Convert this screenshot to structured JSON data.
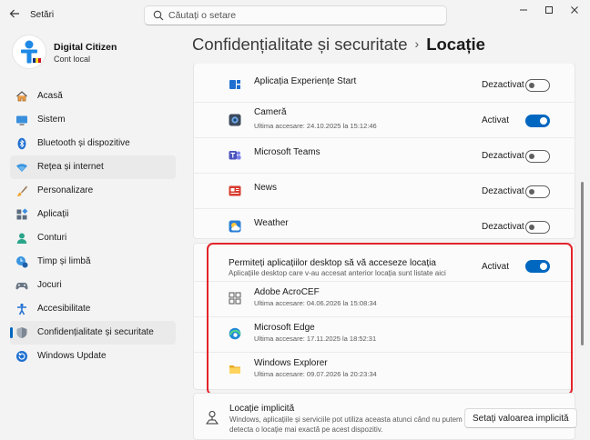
{
  "window": {
    "title": "Setări",
    "search_placeholder": "Căutați o setare"
  },
  "profile": {
    "name": "Digital Citizen",
    "account_type": "Cont local"
  },
  "sidebar": {
    "items": [
      {
        "label": "Acasă",
        "icon": "home-icon"
      },
      {
        "label": "Sistem",
        "icon": "system-icon"
      },
      {
        "label": "Bluetooth și dispozitive",
        "icon": "bluetooth-icon"
      },
      {
        "label": "Rețea și internet",
        "icon": "wifi-icon"
      },
      {
        "label": "Personalizare",
        "icon": "brush-icon"
      },
      {
        "label": "Aplicații",
        "icon": "apps-icon"
      },
      {
        "label": "Conturi",
        "icon": "accounts-icon"
      },
      {
        "label": "Timp și limbă",
        "icon": "time-language-icon"
      },
      {
        "label": "Jocuri",
        "icon": "gaming-icon"
      },
      {
        "label": "Accesibilitate",
        "icon": "accessibility-icon"
      },
      {
        "label": "Confidențialitate și securitate",
        "icon": "shield-icon"
      },
      {
        "label": "Windows Update",
        "icon": "update-icon"
      }
    ],
    "selected_index": 10,
    "hover_index": 3
  },
  "breadcrumb": {
    "parent": "Confidențialitate și securitate",
    "separator": "›",
    "current": "Locație"
  },
  "apps": [
    {
      "name": "Aplicația Experiențe Start",
      "last_access": "",
      "state": "Dezactivat",
      "on": false,
      "icon": "start-experiences-icon"
    },
    {
      "name": "Cameră",
      "last_access": "Ultima accesare: 24.10.2025 la 15:12:46",
      "state": "Activat",
      "on": true,
      "icon": "camera-icon"
    },
    {
      "name": "Microsoft Teams",
      "last_access": "",
      "state": "Dezactivat",
      "on": false,
      "icon": "teams-icon"
    },
    {
      "name": "News",
      "last_access": "",
      "state": "Dezactivat",
      "on": false,
      "icon": "news-icon"
    },
    {
      "name": "Weather",
      "last_access": "",
      "state": "Dezactivat",
      "on": false,
      "icon": "weather-icon"
    }
  ],
  "desktop_apps": {
    "title": "Permiteți aplicațiilor desktop să vă acceseze locația",
    "subtitle": "Aplicațiile desktop care v-au accesat anterior locația sunt listate aici",
    "state": "Activat",
    "on": true,
    "items": [
      {
        "name": "Adobe AcroCEF",
        "last_access": "Ultima accesare: 04.06.2026 la 15:08:34",
        "icon": "acrocef-icon"
      },
      {
        "name": "Microsoft Edge",
        "last_access": "Ultima accesare: 17.11.2025 la 18:52:31",
        "icon": "edge-icon"
      },
      {
        "name": "Windows Explorer",
        "last_access": "Ultima accesare: 09.07.2026 la 20:23:34",
        "icon": "explorer-icon"
      }
    ]
  },
  "default_location": {
    "title": "Locație implicită",
    "description": "Windows, aplicațiile și serviciile pot utiliza aceasta atunci când nu putem detecta o locație mai exactă pe acest dispozitiv.",
    "button_label": "Setați valoarea implicită"
  },
  "colors": {
    "accent": "#0067c0",
    "highlight": "#e3242b"
  }
}
